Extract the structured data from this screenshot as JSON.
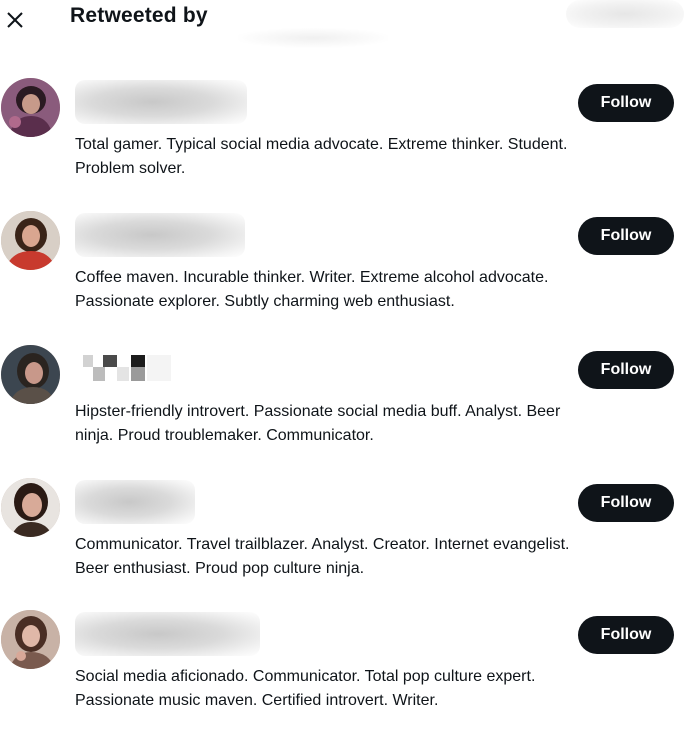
{
  "header": {
    "close_icon": "close-icon",
    "title": "Retweeted by"
  },
  "users": [
    {
      "follow_label": "Follow",
      "bio": "Total gamer. Typical social media advocate. Extreme thinker. Student.\nProblem solver.",
      "avatar_colors": [
        "#8a5b7c",
        "#2a1a22",
        "#c79a8a"
      ]
    },
    {
      "follow_label": "Follow",
      "bio": "Coffee maven. Incurable thinker. Writer. Extreme alcohol advocate.\nPassionate explorer. Subtly charming web enthusiast.",
      "avatar_colors": [
        "#d8cfc6",
        "#3a2418",
        "#c83a2e"
      ]
    },
    {
      "follow_label": "Follow",
      "bio": "Hipster-friendly introvert. Passionate social media buff. Analyst. Beer\nninja. Proud troublemaker. Communicator.",
      "avatar_colors": [
        "#3c4650",
        "#2a2420",
        "#c8988a"
      ]
    },
    {
      "follow_label": "Follow",
      "bio": "Communicator. Travel trailblazer. Analyst. Creator. Internet evangelist.\nBeer enthusiast. Proud pop culture ninja.",
      "avatar_colors": [
        "#e8e4e0",
        "#2a1a14",
        "#d8aa98"
      ]
    },
    {
      "follow_label": "Follow",
      "bio": "Social media aficionado. Communicator. Total pop culture expert.\nPassionate music maven. Certified introvert. Writer.",
      "avatar_colors": [
        "#c8b2a6",
        "#4a2e24",
        "#e0b8a8"
      ]
    }
  ]
}
